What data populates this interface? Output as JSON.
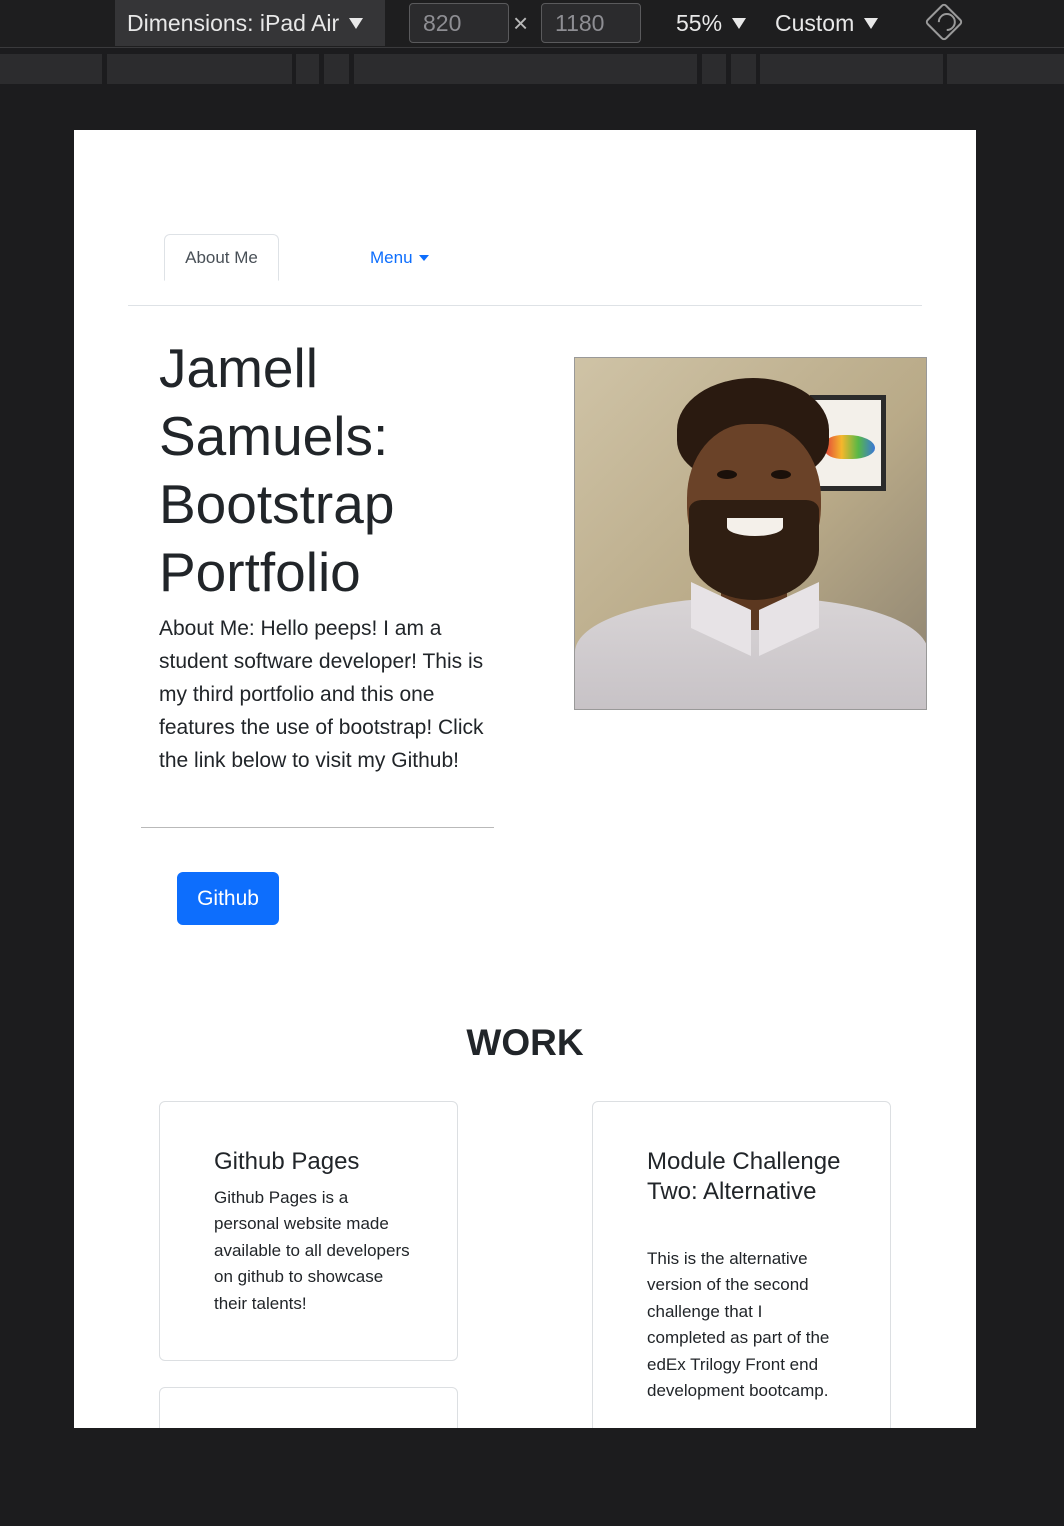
{
  "devtools": {
    "dimensions_label": "Dimensions: iPad Air",
    "width_value": "820",
    "height_value": "1180",
    "times_sign": "×",
    "zoom": "55%",
    "throttle": "Custom"
  },
  "nav": {
    "about_tab": "About Me",
    "menu_label": "Menu"
  },
  "hero": {
    "title": "Jamell Samuels: Bootstrap Portfolio",
    "about_text": "About Me: Hello peeps! I am a student software developer! This is my third portfolio and this one features the use of bootstrap! Click the link below to visit my Github!",
    "github_button": "Github"
  },
  "work": {
    "heading": "WORK",
    "cards": [
      {
        "title": "Github Pages",
        "text": "Github Pages is a personal website made available to all developers on github to showcase their talents!"
      },
      {
        "title": "Module Challenge Two: Alternative",
        "text": "This is the alternative version of the second challenge that I completed as part of the edEx Trilogy Front end development bootcamp."
      }
    ]
  },
  "colors": {
    "primary": "#0d6efd",
    "text": "#212529",
    "devtools_bg": "#1c1c1e"
  }
}
